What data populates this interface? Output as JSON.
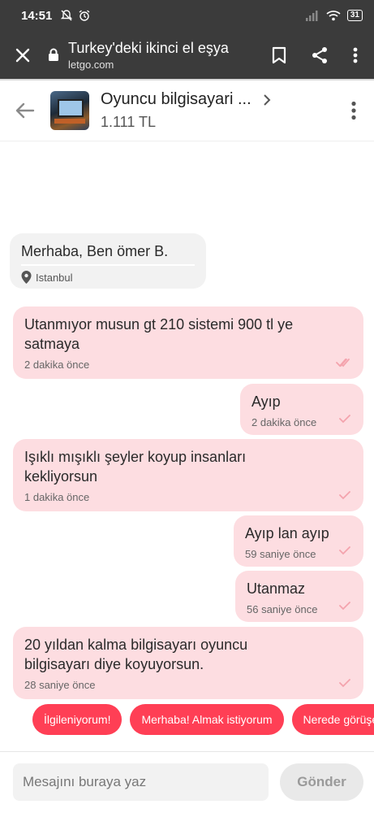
{
  "status_bar": {
    "time": "14:51",
    "battery": "31"
  },
  "browser": {
    "page_title": "Turkey'deki ikinci el eşya",
    "domain": "letgo.com"
  },
  "chat_header": {
    "product_title": "Oyuncu bilgisayari ...",
    "price": "1.111 TL"
  },
  "greeting": {
    "text": "Merhaba, Ben ömer B.",
    "location": "Istanbul"
  },
  "messages": [
    {
      "text": "Utanmıyor musun gt 210 sistemi 900 tl ye satmaya",
      "time": "2 dakika önce"
    },
    {
      "text": "Ayıp",
      "time": "2 dakika önce"
    },
    {
      "text": "Işıklı mışıklı şeyler koyup insanları kekliyorsun",
      "time": "1 dakika önce"
    },
    {
      "text": "Ayıp lan ayıp",
      "time": "59 saniye önce"
    },
    {
      "text": "Utanmaz",
      "time": "56 saniye önce"
    },
    {
      "text": "20 yıldan kalma bilgisayarı oyuncu bilgisayarı diye koyuyorsun.",
      "time": "28 saniye önce"
    }
  ],
  "quick_replies": [
    "İlgileniyorum!",
    "Merhaba! Almak istiyorum",
    "Nerede görüşelim?"
  ],
  "composer": {
    "placeholder": "Mesajını buraya yaz",
    "send_label": "Gönder"
  },
  "colors": {
    "bubble_sent": "#fddde1",
    "bubble_received": "#f2f2f2",
    "chip": "#ff3f55",
    "check": "#f4a3ad"
  }
}
